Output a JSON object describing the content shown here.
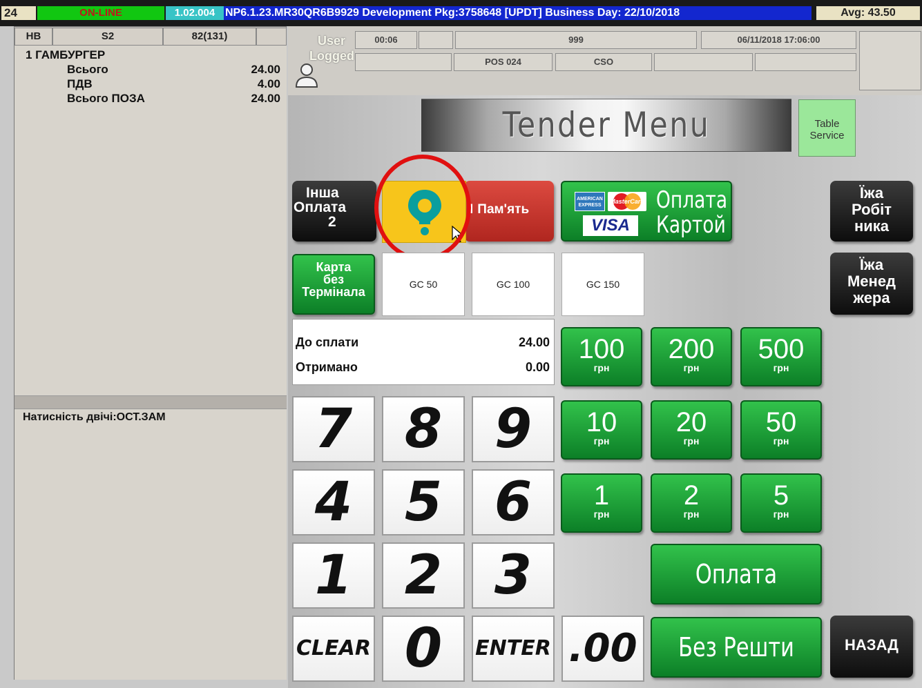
{
  "topbar": {
    "station": "24",
    "status": "ON-LINE",
    "version": "1.02.004",
    "info": "NP6.1.23.MR30QR6B9929 Development Pkg:3758648  [UPDT] Business Day: 22/10/2018",
    "avg": "Avg: 43.50"
  },
  "order_header": {
    "col1": "HB",
    "col2": "S2",
    "col3": "82(131)"
  },
  "order": {
    "item": "1 ГАМБУРГЕР",
    "lines": [
      {
        "label": "Всього",
        "value": "24.00"
      },
      {
        "label": "ПДВ",
        "value": "4.00"
      },
      {
        "label": "Всього ПОЗА",
        "value": "24.00"
      }
    ]
  },
  "message": "Натисність двічі:ОСТ.ЗАМ",
  "header": {
    "user_label_1": "User",
    "user_label_2": "Logged",
    "timer": "00:06",
    "operator": "999",
    "datetime": "06/11/2018 17:06:00",
    "pos": "POS 024",
    "role": "CSO"
  },
  "title": "Tender Menu",
  "table_service": "Table Service",
  "tenders": {
    "other_payment": [
      "Інша",
      "Оплата",
      "2"
    ],
    "memory": "Пам'ять",
    "memory_prefix": "І",
    "card_pay": [
      "Оплата",
      "Картой"
    ],
    "card_logos": {
      "amex": "AMERICAN EXPRESS",
      "mastercard": "MasterCard",
      "visa": "VISA"
    },
    "card_no_terminal": [
      "Карта",
      "без",
      "Термінала"
    ],
    "gc": [
      "GC 50",
      "GC 100",
      "GC 150"
    ],
    "staff_meal": [
      "Їжа",
      "Робіт",
      "ника"
    ],
    "manager_meal": [
      "Їжа",
      "Менед",
      "жера"
    ]
  },
  "amounts": {
    "due_label": "До сплати",
    "due_value": "24.00",
    "received_label": "Отримано",
    "received_value": "0.00"
  },
  "keypad": {
    "k7": "7",
    "k8": "8",
    "k9": "9",
    "k4": "4",
    "k5": "5",
    "k6": "6",
    "k1": "1",
    "k2": "2",
    "k3": "3",
    "clear": "CLEAR",
    "k0": "0",
    "enter": "ENTER",
    "dec": ".00"
  },
  "cash": {
    "unit": "грн",
    "c100": "100",
    "c200": "200",
    "c500": "500",
    "c10": "10",
    "c20": "20",
    "c50": "50",
    "c1": "1",
    "c2": "2",
    "c5": "5"
  },
  "pay": "Оплата",
  "exact": "Без Решти",
  "back": "НАЗАД",
  "colors": {
    "accent_green": "#1ea33a",
    "highlight_ring": "#e01010",
    "app_tile": "#f6c51d",
    "memory_red": "#c8302a"
  }
}
